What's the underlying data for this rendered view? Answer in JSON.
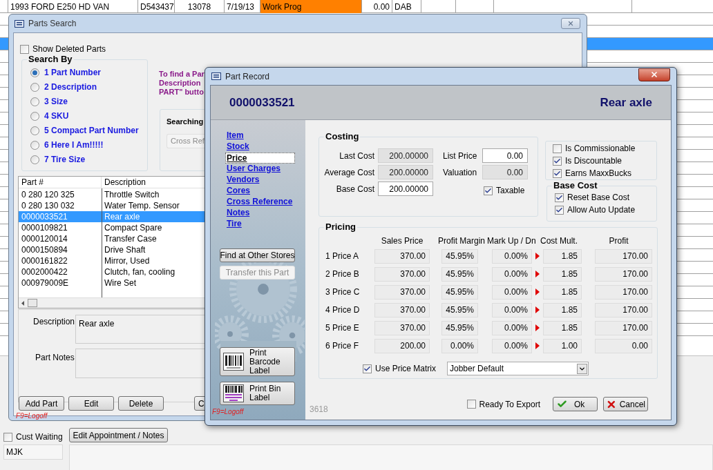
{
  "background": {
    "row": [
      "1993 FORD  E250 HD VAN",
      "D543437",
      "13078",
      "7/19/13",
      "Work Prog",
      "0.00",
      "DAB"
    ],
    "cust_waiting": {
      "label": "Cust Waiting",
      "checked": false
    },
    "appointment_button": "Edit Appointment / Notes",
    "user_field": "MJK"
  },
  "parts_search": {
    "title": "Parts Search",
    "show_deleted": {
      "label": "Show Deleted Parts",
      "checked": false
    },
    "search_by": {
      "title": "Search By",
      "options": [
        {
          "label": "1 Part Number",
          "selected": true
        },
        {
          "label": "2 Description",
          "selected": false
        },
        {
          "label": "3 Size",
          "selected": false
        },
        {
          "label": "4 SKU",
          "selected": false
        },
        {
          "label": "5 Compact Part Number",
          "selected": false
        },
        {
          "label": "6 Here I Am!!!!!",
          "selected": false
        },
        {
          "label": "7 Tire Size",
          "selected": false
        }
      ]
    },
    "hint_lines": [
      "To find a Par",
      "Description",
      "PART\" butto"
    ],
    "searching": {
      "title": "Searching",
      "button": "Cross Ref"
    },
    "table": {
      "columns": [
        "Part #",
        "Description"
      ],
      "rows": [
        {
          "cells": [
            "0 280 120 325",
            "Throttle Switch"
          ],
          "selected": false
        },
        {
          "cells": [
            "0 280 130 032",
            "Water Temp. Sensor"
          ],
          "selected": false
        },
        {
          "cells": [
            "0000033521",
            "Rear axle"
          ],
          "selected": true
        },
        {
          "cells": [
            "0000109821",
            "Compact Spare"
          ],
          "selected": false
        },
        {
          "cells": [
            "0000120014",
            "Transfer Case"
          ],
          "selected": false
        },
        {
          "cells": [
            "0000150894",
            "Drive Shaft"
          ],
          "selected": false
        },
        {
          "cells": [
            "0000161822",
            "Mirror, Used"
          ],
          "selected": false
        },
        {
          "cells": [
            "0002000422",
            "Clutch, fan, cooling"
          ],
          "selected": false
        },
        {
          "cells": [
            "000979009E",
            "Wire Set"
          ],
          "selected": false
        }
      ]
    },
    "description": {
      "label": "Description",
      "value": "Rear axle"
    },
    "part_notes": {
      "label": "Part Notes"
    },
    "buttons": [
      "Add Part",
      "Edit",
      "Delete",
      "C"
    ],
    "logoff": "F9=Logoff"
  },
  "part_record": {
    "title": "Part Record",
    "part_number": "0000033521",
    "part_name": "Rear axle",
    "nav": [
      {
        "label": "Item",
        "selected": false
      },
      {
        "label": "Stock",
        "selected": false
      },
      {
        "label": "Price",
        "selected": true
      },
      {
        "label": "User Charges",
        "selected": false
      },
      {
        "label": "Vendors",
        "selected": false
      },
      {
        "label": "Cores",
        "selected": false
      },
      {
        "label": "Cross Reference",
        "selected": false
      },
      {
        "label": "Notes",
        "selected": false
      },
      {
        "label": "Tire",
        "selected": false
      }
    ],
    "side_buttons": [
      {
        "label": "Find at Other Stores",
        "disabled": false
      },
      {
        "label": "Transfer this Part",
        "disabled": true
      }
    ],
    "print_buttons": [
      {
        "label": "Print Barcode Label",
        "kind": "barcode"
      },
      {
        "label": "Print Bin Label",
        "kind": "bin"
      }
    ],
    "logoff": "F9=Logoff",
    "costing": {
      "title": "Costing",
      "fields": [
        {
          "label": "Last Cost",
          "value": "200.00000",
          "disabled": true
        },
        {
          "label": "Average Cost",
          "value": "200.00000",
          "disabled": true
        },
        {
          "label": "Base Cost",
          "value": "200.00000",
          "disabled": false
        }
      ],
      "right_fields": [
        {
          "label": "List Price",
          "value": "0.00",
          "disabled": false
        },
        {
          "label": "Valuation",
          "value": "0.00",
          "disabled": true
        }
      ],
      "taxable": {
        "label": "Taxable",
        "checked": true
      }
    },
    "flags": [
      {
        "label": "Is Commissionable",
        "checked": false
      },
      {
        "label": "Is Discountable",
        "checked": true
      },
      {
        "label": "Earns MaxxBucks",
        "checked": true
      }
    ],
    "base_cost": {
      "title": "Base Cost",
      "options": [
        {
          "label": "Reset Base Cost",
          "checked": true
        },
        {
          "label": "Allow Auto Update",
          "checked": true
        }
      ]
    },
    "pricing": {
      "title": "Pricing",
      "columns": [
        "Sales Price",
        "Profit Margin",
        "Mark Up / Dn",
        "Cost Mult.",
        "Profit"
      ],
      "rows": [
        {
          "label": "1 Price A",
          "cells": [
            "370.00",
            "45.95%",
            "0.00%",
            "1.85",
            "170.00"
          ]
        },
        {
          "label": "2 Price B",
          "cells": [
            "370.00",
            "45.95%",
            "0.00%",
            "1.85",
            "170.00"
          ]
        },
        {
          "label": "3 Price C",
          "cells": [
            "370.00",
            "45.95%",
            "0.00%",
            "1.85",
            "170.00"
          ]
        },
        {
          "label": "4 Price D",
          "cells": [
            "370.00",
            "45.95%",
            "0.00%",
            "1.85",
            "170.00"
          ]
        },
        {
          "label": "5 Price E",
          "cells": [
            "370.00",
            "45.95%",
            "0.00%",
            "1.85",
            "170.00"
          ]
        },
        {
          "label": "6 Price F",
          "cells": [
            "200.00",
            "0.00%",
            "0.00%",
            "1.00",
            "0.00"
          ]
        }
      ],
      "use_price_matrix": {
        "label": "Use Price Matrix",
        "checked": true
      },
      "matrix": "Jobber Default"
    },
    "ready_to_export": {
      "label": "Ready To Export",
      "checked": false
    },
    "ok": "Ok",
    "cancel": "Cancel",
    "record_id": "3618"
  }
}
